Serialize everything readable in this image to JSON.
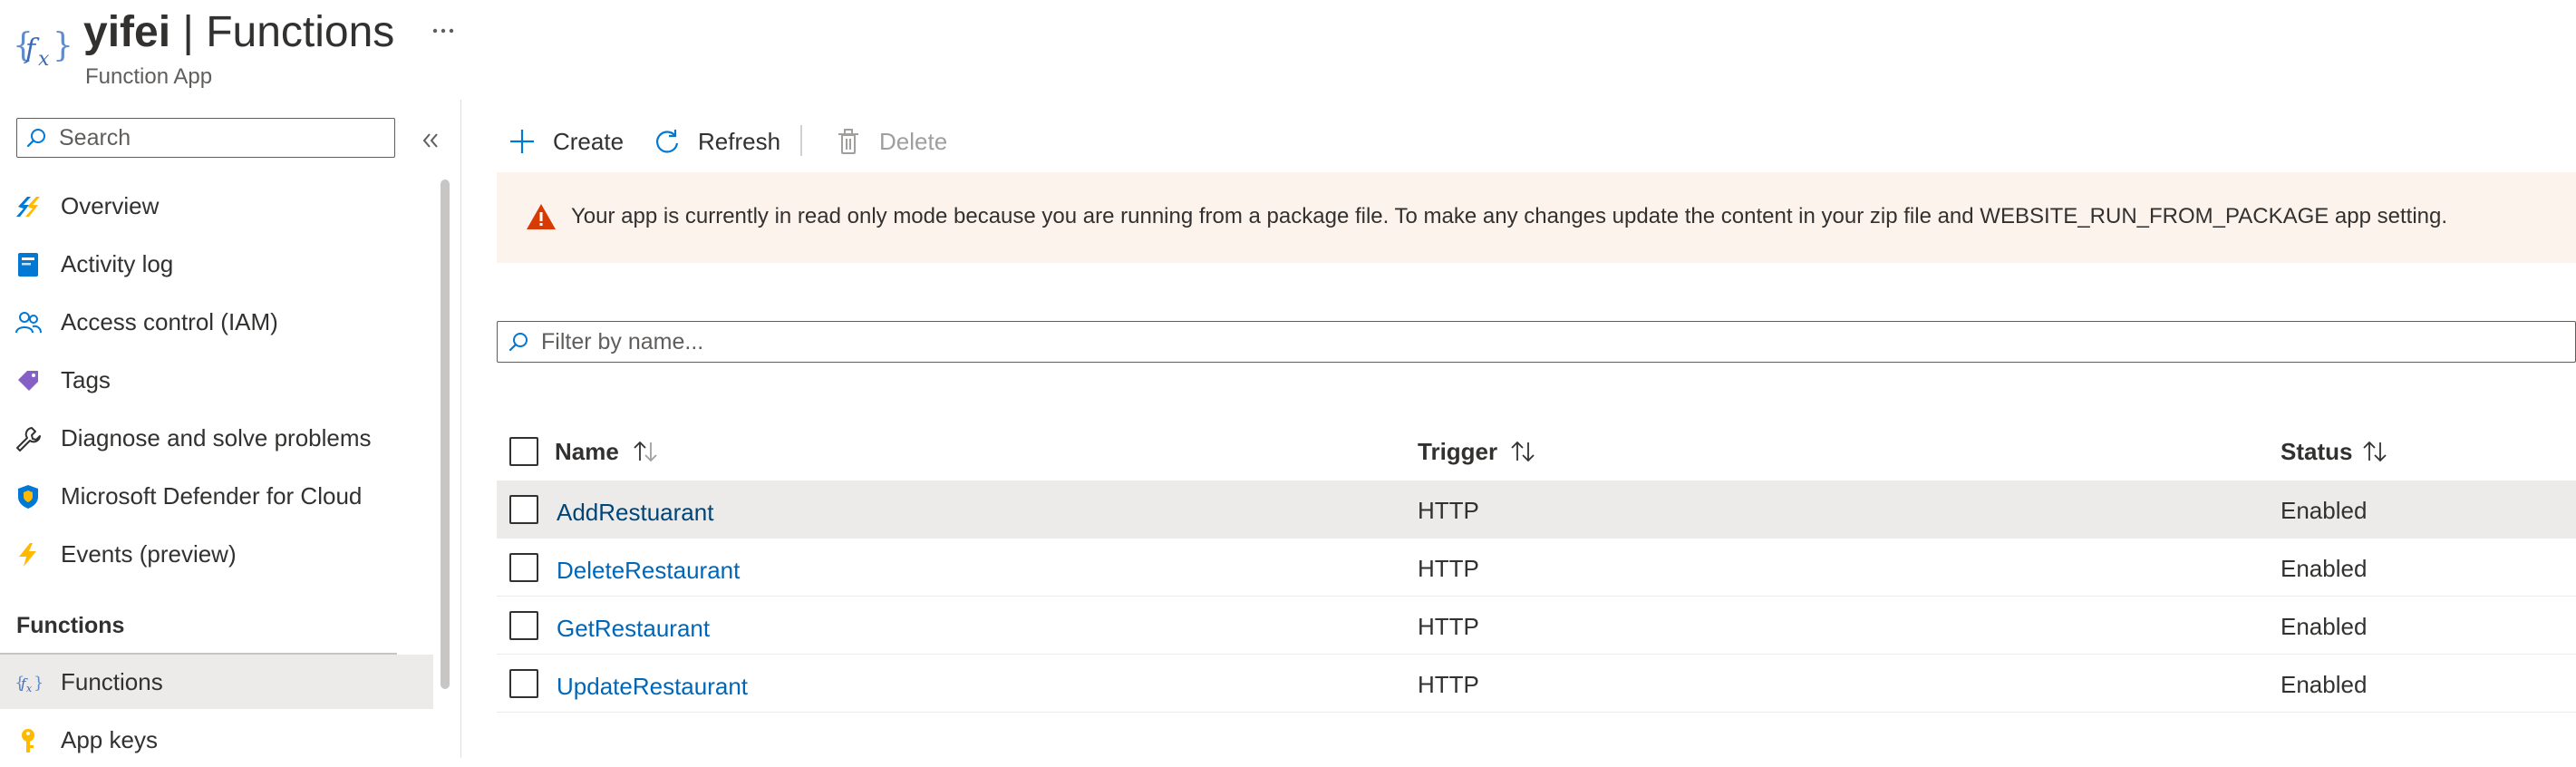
{
  "header": {
    "icon": "function-app-icon",
    "resource_name": "yifei",
    "title_suffix": "| Functions",
    "subtitle": "Function App",
    "more_icon": "more-horizontal-icon"
  },
  "sidebar": {
    "search_placeholder": "Search",
    "collapse_icon": "double-chevron-left-icon",
    "items": [
      {
        "label": "Overview",
        "icon": "overview-bolt-icon"
      },
      {
        "label": "Activity log",
        "icon": "activity-log-icon"
      },
      {
        "label": "Access control (IAM)",
        "icon": "people-icon"
      },
      {
        "label": "Tags",
        "icon": "tag-icon"
      },
      {
        "label": "Diagnose and solve problems",
        "icon": "wrench-icon"
      },
      {
        "label": "Microsoft Defender for Cloud",
        "icon": "shield-icon"
      },
      {
        "label": "Events (preview)",
        "icon": "lightning-icon"
      }
    ],
    "section_title": "Functions",
    "section_items": [
      {
        "label": "Functions",
        "icon": "function-icon",
        "active": true
      },
      {
        "label": "App keys",
        "icon": "key-icon"
      }
    ]
  },
  "toolbar": {
    "create_label": "Create",
    "refresh_label": "Refresh",
    "delete_label": "Delete"
  },
  "banner": {
    "icon": "warning-icon",
    "text": "Your app is currently in read only mode because you are running from a package file. To make any changes update the content in your zip file and WEBSITE_RUN_FROM_PACKAGE app setting."
  },
  "filter": {
    "placeholder": "Filter by name..."
  },
  "table": {
    "columns": [
      "Name",
      "Trigger",
      "Status"
    ],
    "rows": [
      {
        "name": "AddRestuarant",
        "trigger": "HTTP",
        "status": "Enabled"
      },
      {
        "name": "DeleteRestaurant",
        "trigger": "HTTP",
        "status": "Enabled"
      },
      {
        "name": "GetRestaurant",
        "trigger": "HTTP",
        "status": "Enabled"
      },
      {
        "name": "UpdateRestaurant",
        "trigger": "HTTP",
        "status": "Enabled"
      }
    ]
  },
  "colors": {
    "link": "#0067b8",
    "warning": "#d83b01",
    "banner_bg": "#fdf3ed",
    "accent": "#0078d4"
  }
}
